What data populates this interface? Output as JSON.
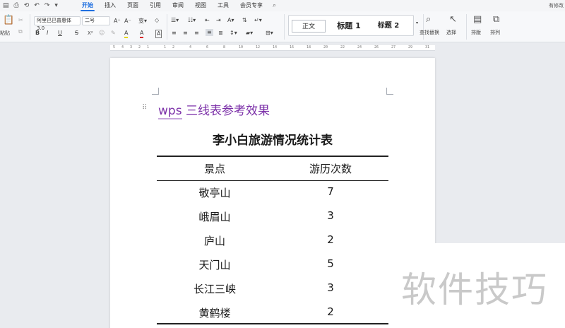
{
  "menubar": {
    "quick_access": [
      "▤",
      "⎙",
      "⟲",
      "↶",
      "↷",
      "▾"
    ],
    "tabs": [
      "开始",
      "插入",
      "页面",
      "引用",
      "审阅",
      "视图",
      "工具",
      "会员专享"
    ],
    "active_tab": "开始",
    "search_icon": "⌕",
    "right_status": "有修改"
  },
  "ribbon": {
    "paste_label": "粘贴",
    "format_painter": "格式刷",
    "font_name": "阿里巴巴普惠体 3.0",
    "font_size": "二号",
    "font_grow": "A⁺",
    "font_shrink": "A⁻",
    "clear_format": "◇",
    "bold": "B",
    "italic": "I",
    "underline": "U",
    "strike": "S",
    "superscript": "X²",
    "highlight": "A",
    "font_color": "A",
    "char_border": "A",
    "style_normal": "正文",
    "style_h1": "标题 1",
    "style_h2": "标题 2",
    "find_replace": "查找替换",
    "select": "选择",
    "typeset": "排版",
    "arrange": "排列"
  },
  "ruler": {
    "numbers": [
      "5",
      "4",
      "3",
      "2",
      "1",
      "1",
      "2",
      "4",
      "6",
      "8",
      "10",
      "12",
      "14",
      "16",
      "18",
      "20",
      "22",
      "24",
      "26",
      "27",
      "29",
      "31"
    ]
  },
  "document": {
    "heading_prefix": "wps",
    "heading_rest": " 三线表参考效果",
    "table_title": "李小白旅游情况统计表",
    "table": {
      "headers": [
        "景点",
        "游历次数"
      ],
      "rows": [
        [
          "敬亭山",
          "7"
        ],
        [
          "峨眉山",
          "3"
        ],
        [
          "庐山",
          "2"
        ],
        [
          "天门山",
          "5"
        ],
        [
          "长江三峡",
          "3"
        ],
        [
          "黄鹤楼",
          "2"
        ]
      ]
    }
  },
  "watermark": "软件技巧",
  "colors": {
    "accent": "#1f6fe0",
    "heading": "#7b2fa8"
  }
}
